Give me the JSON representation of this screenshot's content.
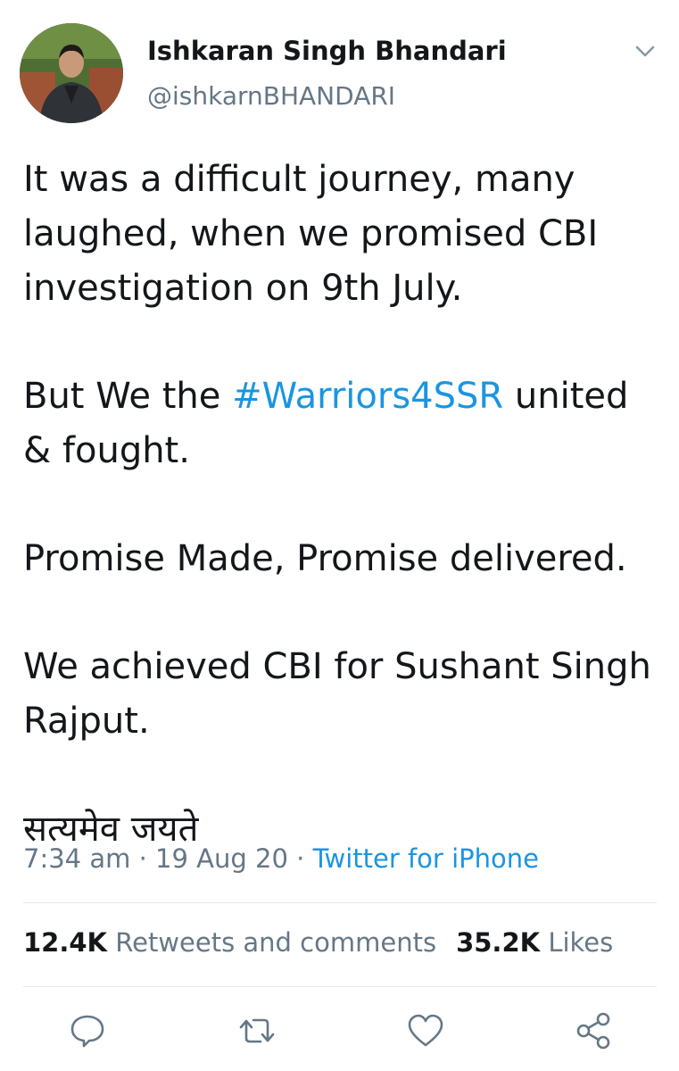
{
  "author": {
    "name": "Ishkaran Singh Bhandari",
    "handle": "@ishkarnBHANDARI"
  },
  "tweet": {
    "p1": "It was a difficult journey, many laughed, when we promised CBI investigation on 9th July.",
    "p2_before": "But We the ",
    "p2_hashtag": "#Warriors4SSR",
    "p2_after": " united & fought.",
    "p3": "Promise Made, Promise delivered.",
    "p4": "We achieved CBI for Sushant Singh Rajput.",
    "p5": "सत्यमेव जयते"
  },
  "meta": {
    "time": "7:34 am",
    "sep1": " · ",
    "date": "19 Aug 20",
    "sep2": " · ",
    "source": "Twitter for iPhone"
  },
  "stats": {
    "retweets_count": "12.4K",
    "retweets_label": "Retweets and comments",
    "likes_count": "35.2K",
    "likes_label": "Likes"
  },
  "icons": {
    "caret": "chevron-down-icon",
    "reply": "reply-icon",
    "retweet": "retweet-icon",
    "like": "heart-icon",
    "share": "share-icon"
  },
  "colors": {
    "link": "#1b95e0",
    "secondary": "#657786",
    "text": "#14171a",
    "divider": "#e1e8ed"
  }
}
